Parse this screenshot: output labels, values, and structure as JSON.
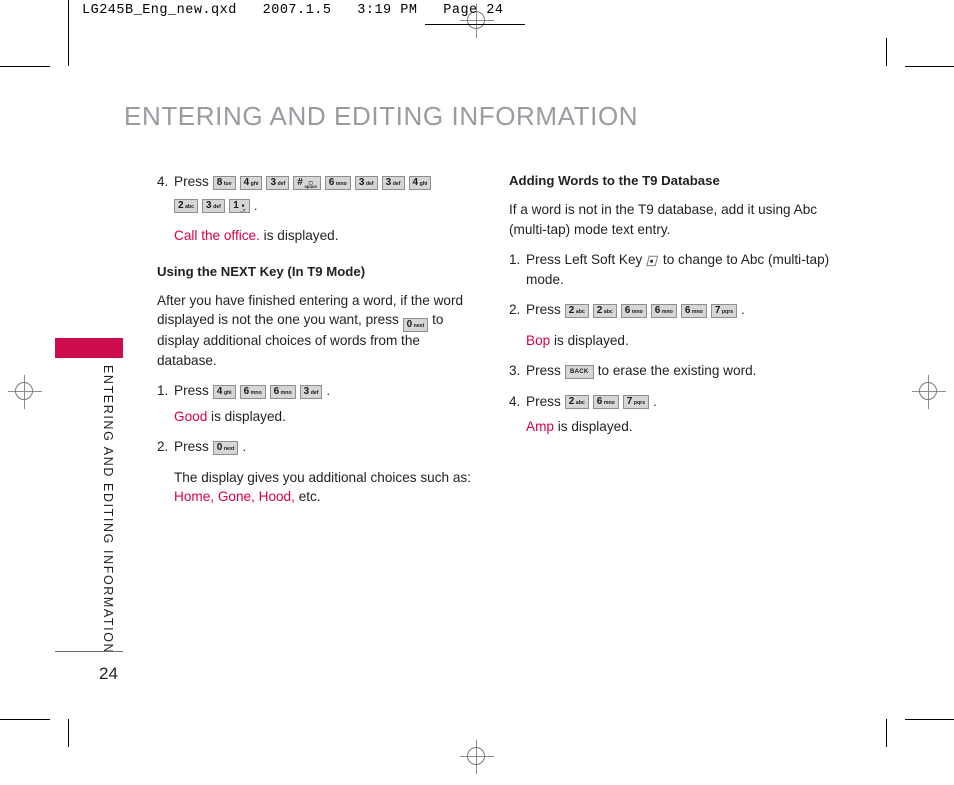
{
  "printer_slug": {
    "text": "LG245B_Eng_new.qxd   2007.1.5   3:19 PM   Page 24"
  },
  "document": {
    "title": "ENTERING AND EDITING INFORMATION",
    "page_number": "24",
    "side_tab_text": "ENTERING AND EDITING INFORMATION",
    "accent_color": "#CC0A4E",
    "highlight_color": "#D6004F",
    "title_color": "#9A9BA0"
  },
  "left_column": {
    "step4": {
      "num": "4.",
      "press": "Press",
      "keys_row1": [
        {
          "digit": "8",
          "sub": "tuv"
        },
        {
          "digit": "4",
          "sub": "ghi"
        },
        {
          "digit": "3",
          "sub": "def"
        },
        {
          "digit": "#",
          "sub": "space"
        },
        {
          "digit": "6",
          "sub": "mno"
        },
        {
          "digit": "3",
          "sub": "def"
        },
        {
          "digit": "3",
          "sub": "def"
        },
        {
          "digit": "4",
          "sub": "ghi"
        }
      ],
      "keys_row2": [
        {
          "digit": "2",
          "sub": "abc"
        },
        {
          "digit": "3",
          "sub": "def"
        },
        {
          "digit": "1",
          "sub": ".,?"
        }
      ],
      "period": ".",
      "result_word": "Call the office.",
      "result_text": "is displayed."
    },
    "heading": "Using the NEXT Key (In T9 Mode)",
    "intro_part1": "After you have finished entering a word, if the word displayed is not the one you want, press",
    "intro_key": {
      "digit": "0",
      "sub": "next"
    },
    "intro_part2": "to display additional choices of words from the database.",
    "step1": {
      "num": "1.",
      "press": "Press",
      "keys": [
        {
          "digit": "4",
          "sub": "ghi"
        },
        {
          "digit": "6",
          "sub": "mno"
        },
        {
          "digit": "6",
          "sub": "mno"
        },
        {
          "digit": "3",
          "sub": "def"
        }
      ],
      "period": ".",
      "result_word": "Good",
      "result_text": "is displayed."
    },
    "step2": {
      "num": "2.",
      "press": "Press",
      "keys": [
        {
          "digit": "0",
          "sub": "next"
        }
      ],
      "period": ".",
      "result_text": "The display gives you additional choices such as:",
      "result_word": "Home, Gone, Hood,",
      "result_tail": "etc."
    }
  },
  "right_column": {
    "heading": "Adding Words to the T9 Database",
    "intro": "If a word is not in the T9 database, add it using Abc (multi-tap) mode text entry.",
    "step1": {
      "num": "1.",
      "text_before": "Press Left Soft Key",
      "icon": "left-soft-key-icon",
      "text_after": "to change to Abc (multi-tap) mode."
    },
    "step2": {
      "num": "2.",
      "press": "Press",
      "keys": [
        {
          "digit": "2",
          "sub": "abc"
        },
        {
          "digit": "2",
          "sub": "abc"
        },
        {
          "digit": "6",
          "sub": "mno"
        },
        {
          "digit": "6",
          "sub": "mno"
        },
        {
          "digit": "6",
          "sub": "mno"
        },
        {
          "digit": "7",
          "sub": "pqrs"
        }
      ],
      "period": ".",
      "result_word": "Bop",
      "result_text": "is displayed."
    },
    "step3": {
      "num": "3.",
      "press": "Press",
      "key_label": "BACK",
      "text_after": "to erase the existing word."
    },
    "step4": {
      "num": "4.",
      "press": "Press",
      "keys": [
        {
          "digit": "2",
          "sub": "abc"
        },
        {
          "digit": "6",
          "sub": "mno"
        },
        {
          "digit": "7",
          "sub": "pqrs"
        }
      ],
      "period": ".",
      "result_word": "Amp",
      "result_text": "is displayed."
    }
  }
}
